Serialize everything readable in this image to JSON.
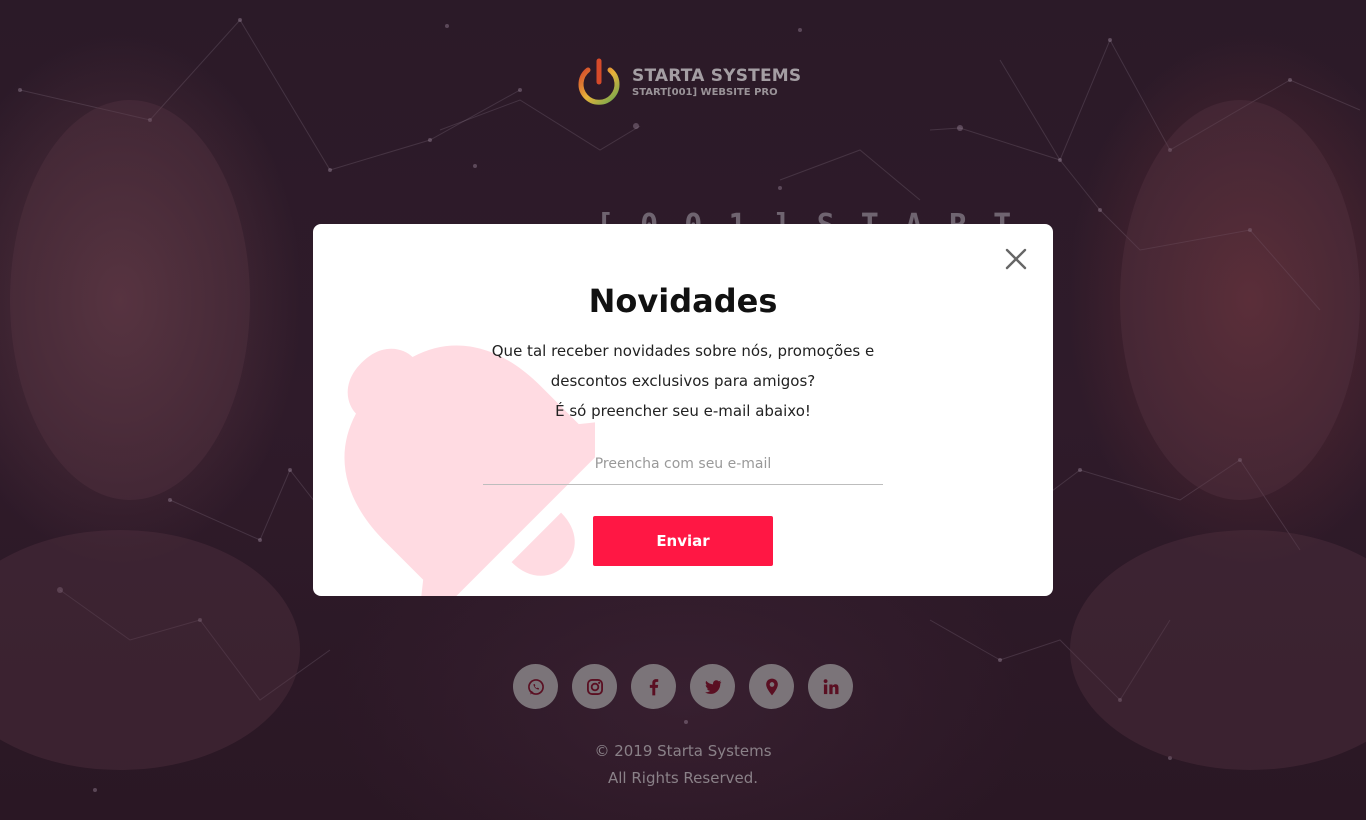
{
  "brand": {
    "name": "STARTA SYSTEMS",
    "tagline": "START[001] WEBSITE PRO",
    "logo_colors": [
      "#d64a2a",
      "#e8b23a",
      "#6aa84f"
    ]
  },
  "background_heading": "[ 0 0 1 ] S T A R T",
  "modal": {
    "title": "Novidades",
    "message_lines": [
      "Que tal receber novidades sobre nós, promoções e",
      "descontos exclusivos para amigos?",
      "É só preencher seu e-mail abaixo!"
    ],
    "email_placeholder": "Preencha com seu e-mail",
    "email_value": "",
    "submit_label": "Enviar",
    "close_icon": "close-icon",
    "decor_icon": "bell-icon",
    "accent_color": "#ff1744",
    "bell_color": "#ffdbe2"
  },
  "socials": [
    {
      "name": "whatsapp-icon"
    },
    {
      "name": "instagram-icon"
    },
    {
      "name": "facebook-icon"
    },
    {
      "name": "twitter-icon"
    },
    {
      "name": "map-pin-icon"
    },
    {
      "name": "linkedin-icon"
    }
  ],
  "social_icon_color": "#5a0f22",
  "footer": {
    "copyright": "© 2019 Starta Systems",
    "rights": "All Rights Reserved."
  }
}
